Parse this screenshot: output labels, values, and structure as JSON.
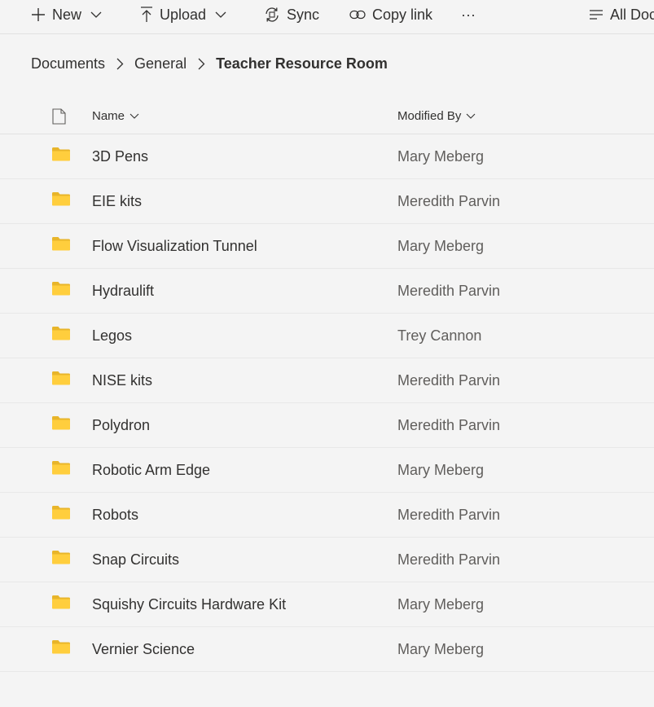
{
  "toolbar": {
    "new_label": "New",
    "upload_label": "Upload",
    "sync_label": "Sync",
    "copy_link_label": "Copy link",
    "more_label": "···",
    "view_label": "All Doc"
  },
  "breadcrumb": {
    "items": [
      "Documents",
      "General"
    ],
    "current": "Teacher Resource Room"
  },
  "list": {
    "columns": {
      "name": "Name",
      "modified_by": "Modified By"
    },
    "rows": [
      {
        "name": "3D Pens",
        "modified_by": "Mary Meberg"
      },
      {
        "name": "EIE kits",
        "modified_by": "Meredith Parvin"
      },
      {
        "name": "Flow Visualization Tunnel",
        "modified_by": "Mary Meberg"
      },
      {
        "name": "Hydraulift",
        "modified_by": "Meredith Parvin"
      },
      {
        "name": "Legos",
        "modified_by": "Trey Cannon"
      },
      {
        "name": "NISE kits",
        "modified_by": "Meredith Parvin"
      },
      {
        "name": "Polydron",
        "modified_by": "Meredith Parvin"
      },
      {
        "name": "Robotic Arm Edge",
        "modified_by": "Mary Meberg"
      },
      {
        "name": "Robots",
        "modified_by": "Meredith Parvin"
      },
      {
        "name": "Snap Circuits",
        "modified_by": "Meredith Parvin"
      },
      {
        "name": "Squishy Circuits Hardware Kit",
        "modified_by": "Mary Meberg"
      },
      {
        "name": "Vernier Science",
        "modified_by": "Mary Meberg"
      }
    ]
  },
  "colors": {
    "background": "#f4f4f4",
    "text": "#323130",
    "secondary_text": "#605e5c",
    "folder_yellow": "#ffce3d",
    "folder_yellow_dark": "#e8b52a"
  }
}
